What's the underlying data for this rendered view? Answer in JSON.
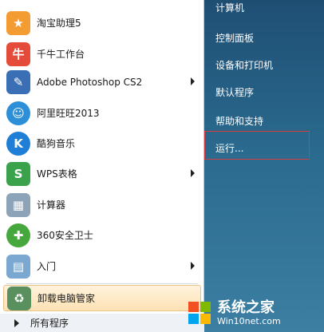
{
  "left_items": [
    {
      "label": "淘宝助理5",
      "icon": "taobao-assistant-icon",
      "color": "#f39c32",
      "glyph": "★",
      "arrow": false
    },
    {
      "label": "千牛工作台",
      "icon": "qianniu-icon",
      "color": "#e54b3b",
      "glyph": "牛",
      "arrow": false
    },
    {
      "label": "Adobe Photoshop CS2",
      "icon": "photoshop-feather-icon",
      "color": "#3a6fb5",
      "glyph": "✎",
      "arrow": true
    },
    {
      "label": "阿里旺旺2013",
      "icon": "aliwangwang-icon",
      "color": "#2d8fd8",
      "glyph": "☺",
      "arrow": false
    },
    {
      "label": "酷狗音乐",
      "icon": "kugou-icon",
      "color": "#1f7fd6",
      "glyph": "K",
      "arrow": false
    },
    {
      "label": "WPS表格",
      "icon": "wps-spreadsheet-icon",
      "color": "#3aa24a",
      "glyph": "S",
      "arrow": true
    },
    {
      "label": "计算器",
      "icon": "calculator-icon",
      "color": "#8ca3b8",
      "glyph": "▦",
      "arrow": false
    },
    {
      "label": "360安全卫士",
      "icon": "360-security-icon",
      "color": "#46a83c",
      "glyph": "✚",
      "arrow": false
    },
    {
      "label": "入门",
      "icon": "getting-started-icon",
      "color": "#7aa8d0",
      "glyph": "▤",
      "arrow": true
    },
    {
      "label": "卸载电脑管家",
      "icon": "recycle-bin-icon",
      "color": "#5a8f5e",
      "glyph": "♻",
      "arrow": false
    }
  ],
  "all_programs": "所有程序",
  "right_items": [
    {
      "label": "计算机",
      "id": "computer"
    },
    {
      "label": "控制面板",
      "id": "control-panel"
    },
    {
      "label": "设备和打印机",
      "id": "devices-printers"
    },
    {
      "label": "默认程序",
      "id": "default-programs"
    },
    {
      "label": "帮助和支持",
      "id": "help-support"
    },
    {
      "label": "运行...",
      "id": "run"
    }
  ],
  "watermark": {
    "title": "系统之家",
    "url": "Win10net.com"
  }
}
